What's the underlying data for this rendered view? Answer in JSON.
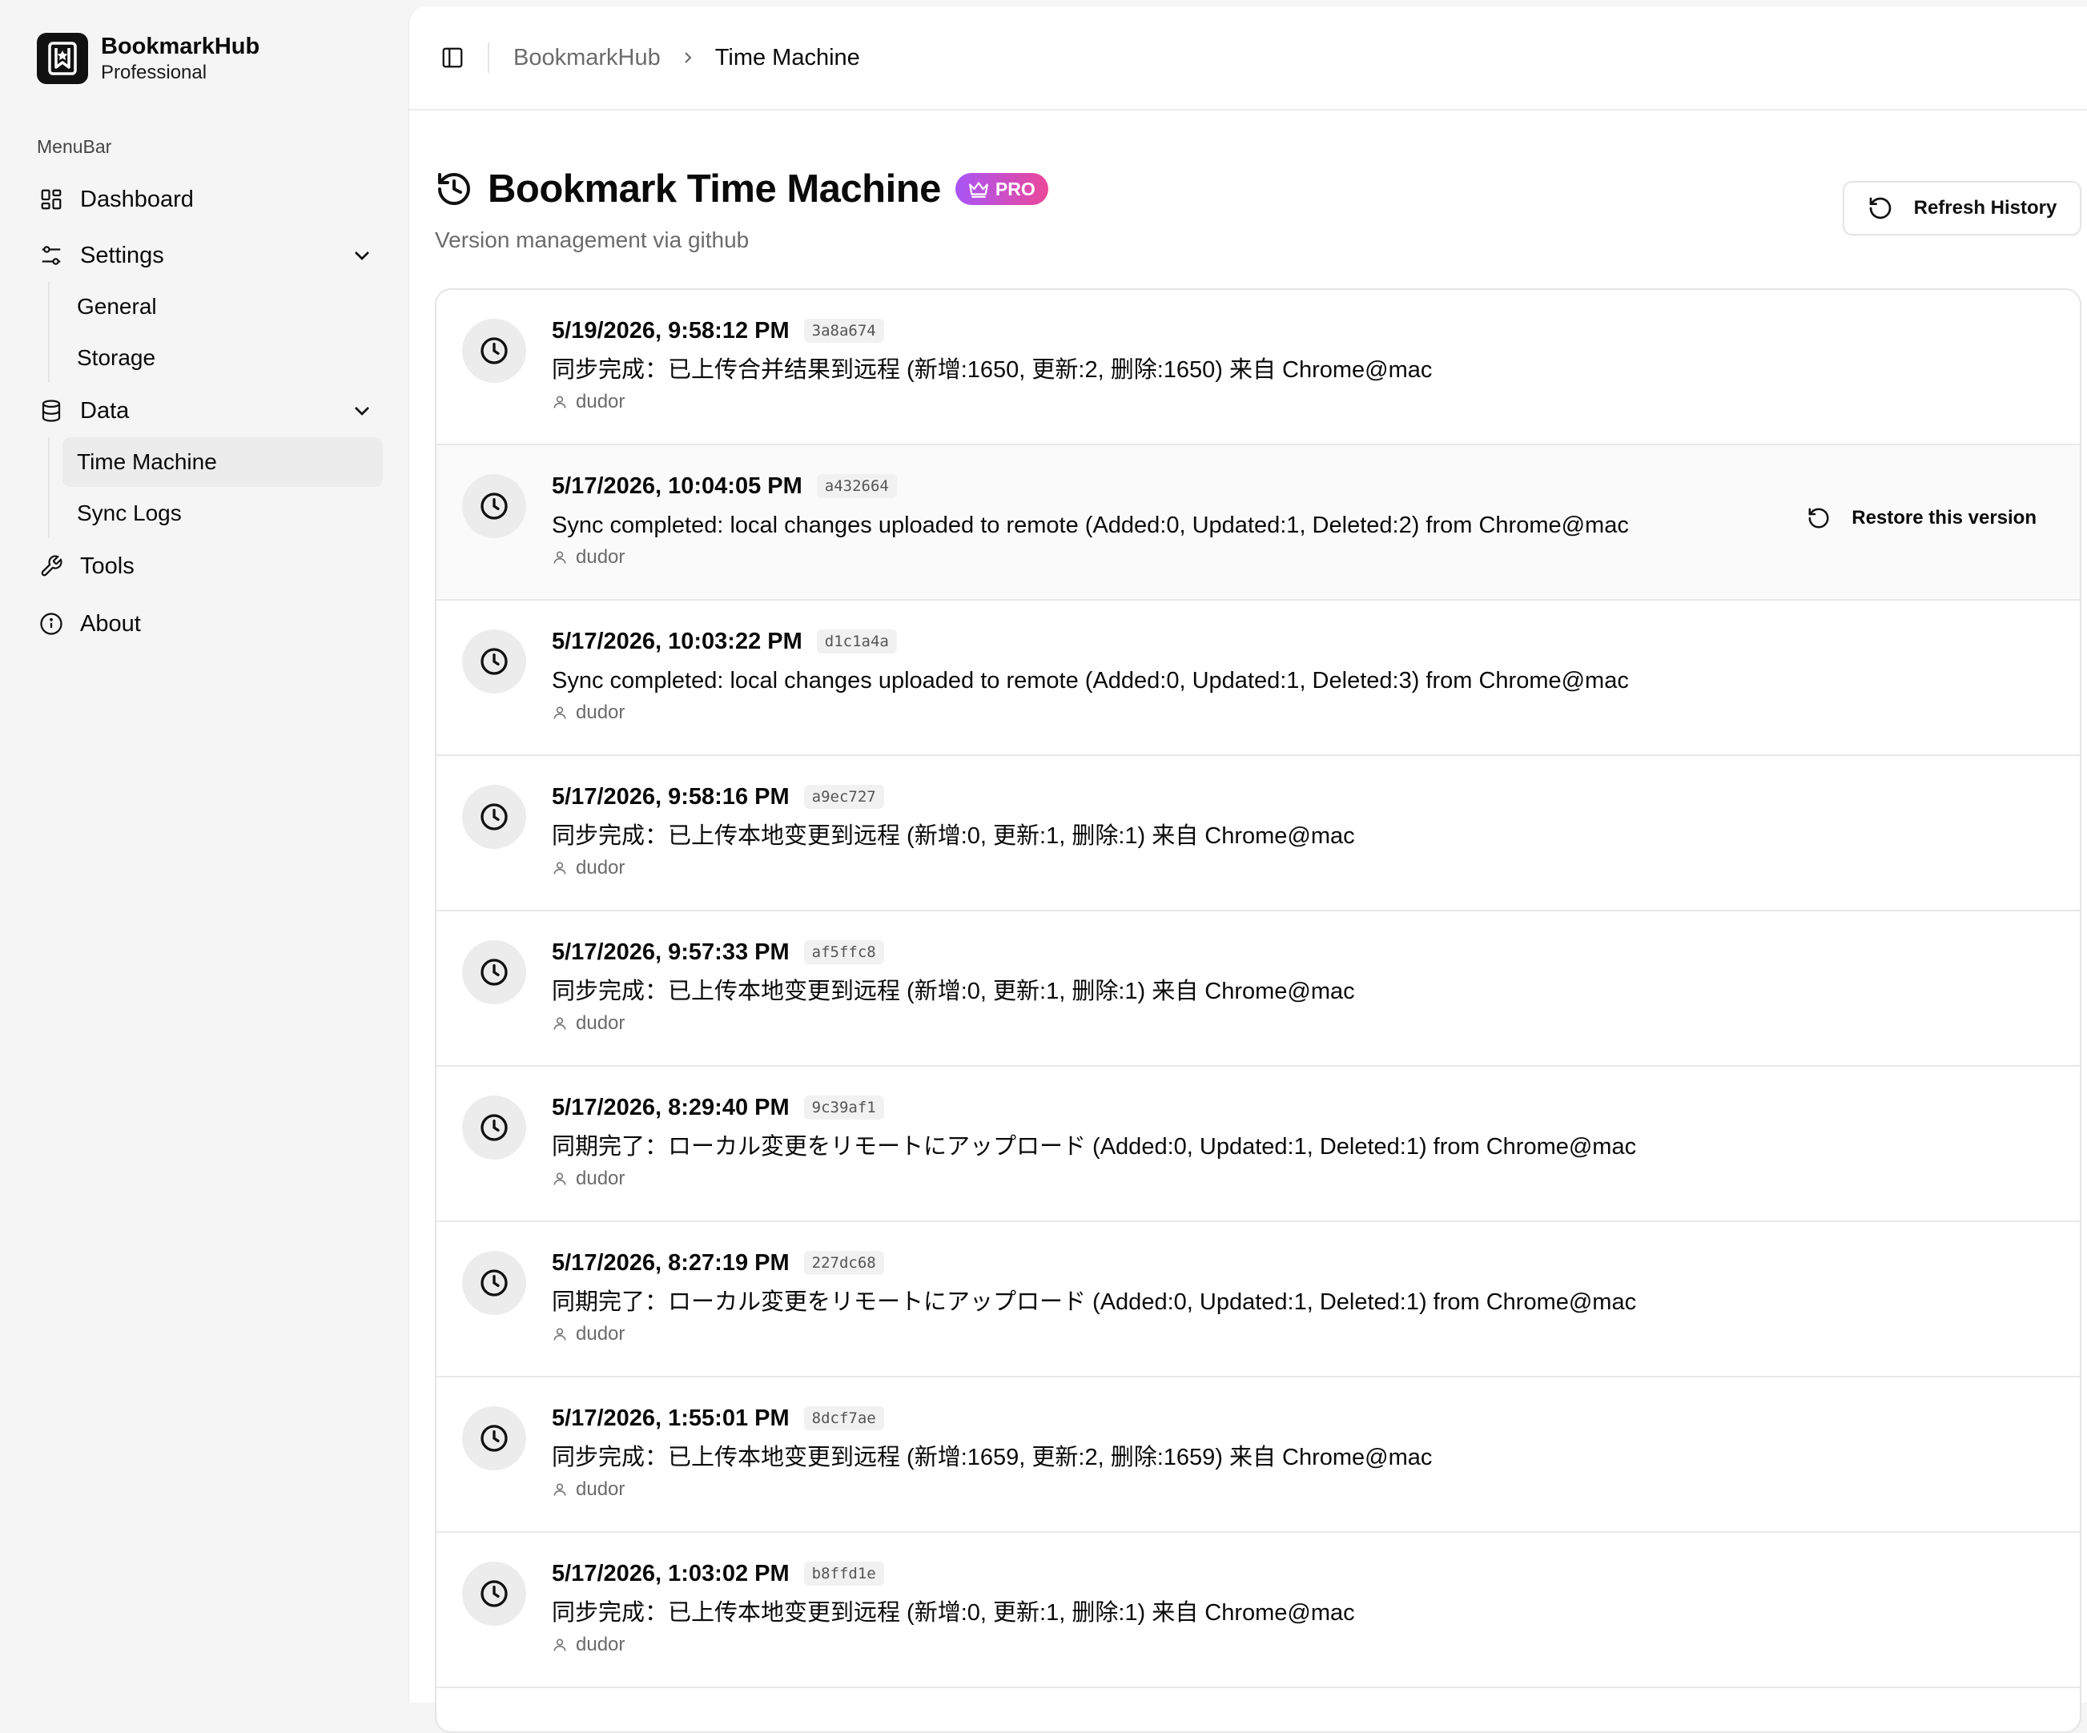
{
  "brand": {
    "name": "BookmarkHub",
    "plan": "Professional"
  },
  "sidebar": {
    "menu_label": "MenuBar",
    "items": [
      {
        "label": "Dashboard",
        "icon": "dashboard-grid-icon"
      },
      {
        "label": "Settings",
        "icon": "sliders-icon",
        "expanded": true,
        "children": [
          {
            "label": "General"
          },
          {
            "label": "Storage"
          }
        ]
      },
      {
        "label": "Data",
        "icon": "database-icon",
        "expanded": true,
        "children": [
          {
            "label": "Time Machine",
            "active": true
          },
          {
            "label": "Sync Logs"
          }
        ]
      },
      {
        "label": "Tools",
        "icon": "wrench-icon"
      },
      {
        "label": "About",
        "icon": "info-icon"
      }
    ]
  },
  "breadcrumb": {
    "root": "BookmarkHub",
    "current": "Time Machine"
  },
  "page": {
    "title": "Bookmark Time Machine",
    "badge": "PRO",
    "subtitle": "Version management via github",
    "refresh_label": "Refresh History"
  },
  "restore_label": "Restore this version",
  "history": [
    {
      "time": "5/19/2026, 9:58:12 PM",
      "hash": "3a8a674",
      "message": "同步完成：已上传合并结果到远程 (新增:1650, 更新:2, 删除:1650) 来自 Chrome@mac",
      "author": "dudor"
    },
    {
      "time": "5/17/2026, 10:04:05 PM",
      "hash": "a432664",
      "message": "Sync completed: local changes uploaded to remote (Added:0, Updated:1, Deleted:2) from Chrome@mac",
      "author": "dudor"
    },
    {
      "time": "5/17/2026, 10:03:22 PM",
      "hash": "d1c1a4a",
      "message": "Sync completed: local changes uploaded to remote (Added:0, Updated:1, Deleted:3) from Chrome@mac",
      "author": "dudor"
    },
    {
      "time": "5/17/2026, 9:58:16 PM",
      "hash": "a9ec727",
      "message": "同步完成：已上传本地变更到远程 (新增:0, 更新:1, 删除:1) 来自 Chrome@mac",
      "author": "dudor"
    },
    {
      "time": "5/17/2026, 9:57:33 PM",
      "hash": "af5ffc8",
      "message": "同步完成：已上传本地变更到远程 (新增:0, 更新:1, 删除:1) 来自 Chrome@mac",
      "author": "dudor"
    },
    {
      "time": "5/17/2026, 8:29:40 PM",
      "hash": "9c39af1",
      "message": "同期完了：ローカル変更をリモートにアップロード (Added:0, Updated:1, Deleted:1) from Chrome@mac",
      "author": "dudor"
    },
    {
      "time": "5/17/2026, 8:27:19 PM",
      "hash": "227dc68",
      "message": "同期完了：ローカル変更をリモートにアップロード (Added:0, Updated:1, Deleted:1) from Chrome@mac",
      "author": "dudor"
    },
    {
      "time": "5/17/2026, 1:55:01 PM",
      "hash": "8dcf7ae",
      "message": "同步完成：已上传本地变更到远程 (新增:1659, 更新:2, 删除:1659) 来自 Chrome@mac",
      "author": "dudor"
    },
    {
      "time": "5/17/2026, 1:03:02 PM",
      "hash": "b8ffd1e",
      "message": "同步完成：已上传本地变更到远程 (新增:0, 更新:1, 删除:1) 来自 Chrome@mac",
      "author": "dudor"
    }
  ],
  "colors": {
    "badge_from": "#a855f7",
    "badge_to": "#ec4899",
    "active_item_bg": "#ececec"
  }
}
